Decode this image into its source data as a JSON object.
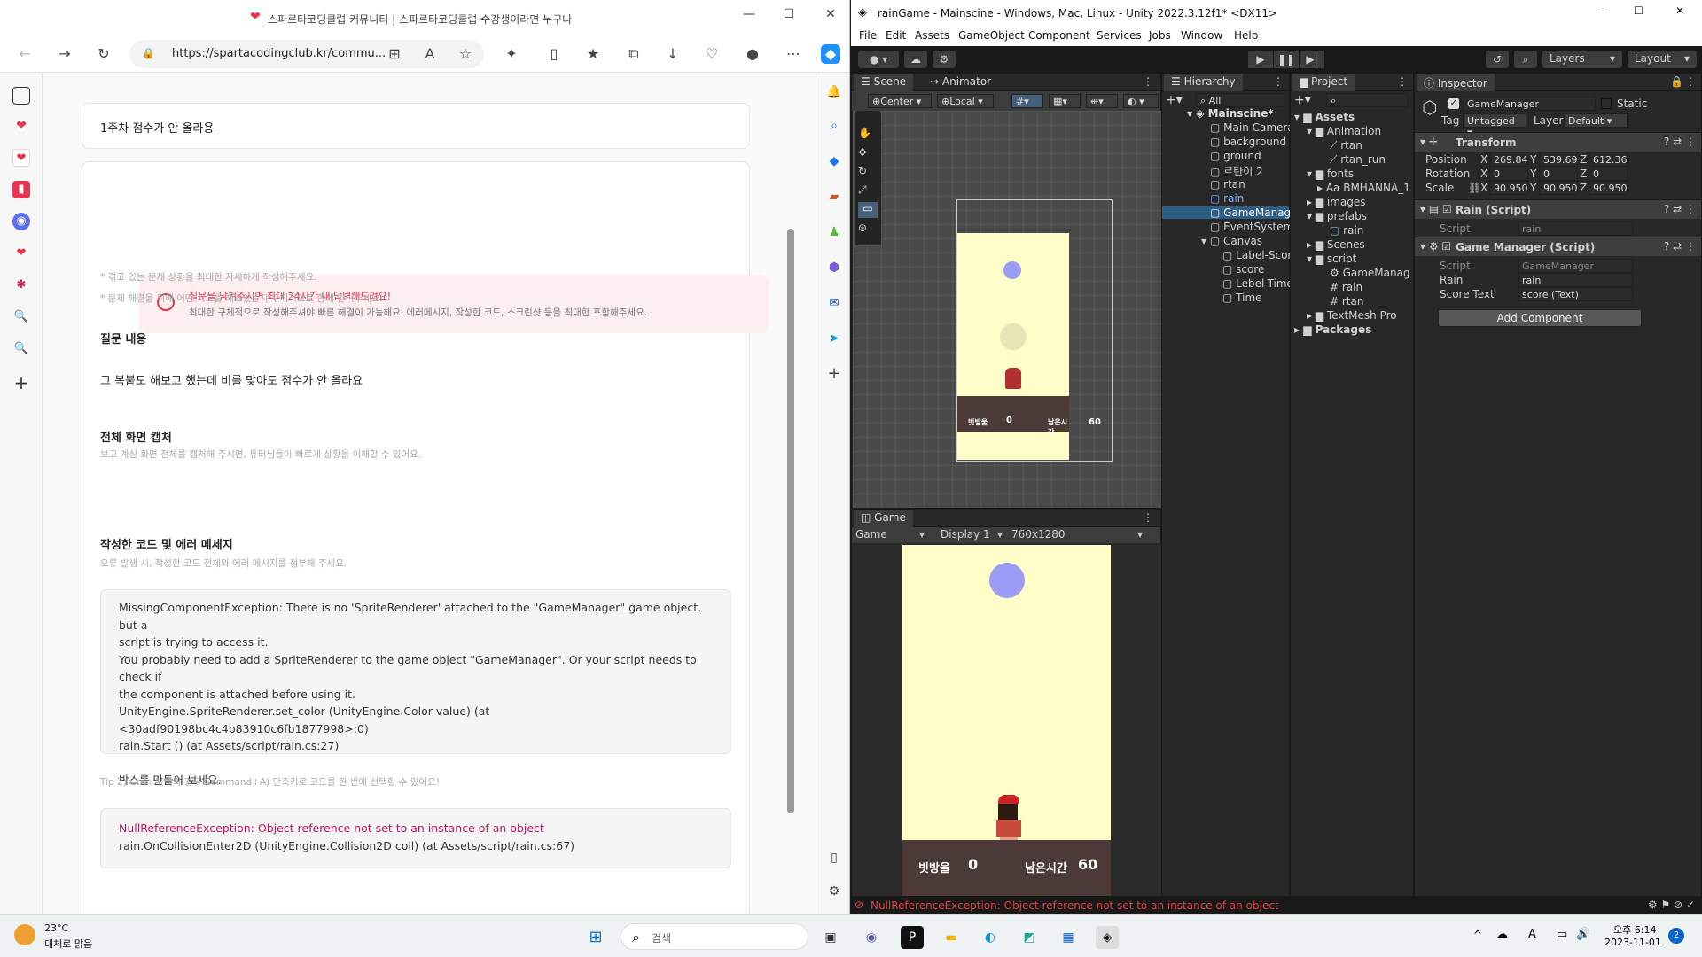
{
  "browser": {
    "tab_title": "스파르타코딩클럽 커뮤니티 | 스파르타코딩클럽 수강생이라면 누구나",
    "url": "https://spartacodingclub.kr/commu..."
  },
  "post": {
    "title": "1주차 점수가 안 올라용",
    "notice_title": "질문을 남겨주시면 최대 24시간 내 답변해드려요!",
    "notice_body": "최대한 구체적으로 작성해주셔야 빠른 해결이 가능해요. 에러메시지, 작성한 코드, 스크린샷 등을 최대한 포함해주세요.",
    "hint1": "* 겪고 있는 문제 상황을 최대한 자세하게 작성해주세요.",
    "hint2": "* 문제 해결을 위해 어떤 시도를 해보았는지 구체적으로 함께 알려주세요.",
    "section_question": "질문 내용",
    "question_body": "그 복붙도 해보고 했는데 비를 맞아도 점수가 안 올라요",
    "section_capture": "전체 화면 캡처",
    "capture_hint": "보고 계신 화면 전체를 캡처해 주시면, 튜터님들이 빠르게 상황을 이해할 수 있어요.",
    "section_code": "작성한 코드 및 에러 메세지",
    "code_hint": "오류 발생 시, 작성한 코드 전체와 에러 메시지를 첨부해 주세요.",
    "code1_lines": [
      "MissingComponentException: There is no 'SpriteRenderer' attached to the \"GameManager\" game object, but a",
      "script is trying to access it.",
      "You probably need to add a SpriteRenderer to the game object \"GameManager\". Or your script needs to check if",
      "the component is attached before using it.",
      "UnityEngine.SpriteRenderer.set_color (UnityEngine.Color value) (at <30adf90198bc4c4b83910c6fb1877998>:0)",
      "rain.Start () (at Assets/script/rain.cs:27)",
      "",
      "박스를 만들어 보세요."
    ],
    "tip": "Tip 2) Ctrl+A(맥의 경우 Command+A) 단축키로 코드를 한 번에 선택할 수 있어요!",
    "code2_lines": [
      "NullReferenceException: Object reference not set to an instance of an object",
      "rain.OnCollisionEnter2D (UnityEngine.Collision2D coll) (at Assets/script/rain.cs:67)"
    ]
  },
  "unity": {
    "window_title": "rainGame - Mainscine - Windows, Mac, Linux - Unity 2022.3.12f1* <DX11>",
    "menu": [
      "File",
      "Edit",
      "Assets",
      "GameObject",
      "Component",
      "Services",
      "Jobs",
      "Window",
      "Help"
    ],
    "toolbar": {
      "layers": "Layers",
      "layout": "Layout"
    },
    "scene_tabs": [
      "Scene",
      "Animator"
    ],
    "scene_toolbar": {
      "pivot": "Center",
      "space": "Local"
    },
    "hierarchy": {
      "tab": "Hierarchy",
      "search": "All",
      "scene": "Mainscine*",
      "items": [
        "Main Camera",
        "background",
        "ground",
        "르탄이 2",
        "rtan",
        "rain",
        "GameManager",
        "EventSystem",
        "Canvas",
        "Label-Score",
        "score",
        "Lebel-Time",
        "Time"
      ]
    },
    "project": {
      "tab": "Project",
      "items": [
        "Assets",
        "Animation",
        "rtan",
        "rtan_run",
        "fonts",
        "BMHANNA_1",
        "images",
        "prefabs",
        "rain",
        "Scenes",
        "script",
        "GameManag",
        "rain",
        "rtan",
        "TextMesh Pro",
        "Packages"
      ]
    },
    "inspector": {
      "tab": "Inspector",
      "object_name": "GameManager",
      "static": "Static",
      "tag_label": "Tag",
      "tag": "Untagged",
      "layer_label": "Layer",
      "layer": "Default",
      "transform": "Transform",
      "position_label": "Position",
      "rotation_label": "Rotation",
      "scale_label": "Scale",
      "position": [
        "269.84",
        "539.69",
        "612.36"
      ],
      "rotation": [
        "0",
        "0",
        "0"
      ],
      "scale": [
        "90.950",
        "90.950",
        "90.950"
      ],
      "rain_script": "Rain (Script)",
      "script_label": "Script",
      "rain_script_value": "rain",
      "gm_script": "Game Manager (Script)",
      "gm_script_value": "GameManager",
      "rain_label": "Rain",
      "rain_value": "rain",
      "score_text_label": "Score Text",
      "score_text_value": "score (Text)",
      "add_component": "Add Component"
    },
    "game": {
      "tab": "Game",
      "mode": "Game",
      "display": "Display 1",
      "resolution": "760x1280",
      "score_label": "빗방울",
      "score": "0",
      "time_label": "남은시간",
      "time": "60"
    },
    "status_error": "NullReferenceException: Object reference not set to an instance of an object"
  },
  "taskbar": {
    "weather_temp": "23°C",
    "weather_desc": "대체로 맑음",
    "search": "검색",
    "time": "오후 6:14",
    "date": "2023-11-01",
    "notif_count": "2"
  }
}
